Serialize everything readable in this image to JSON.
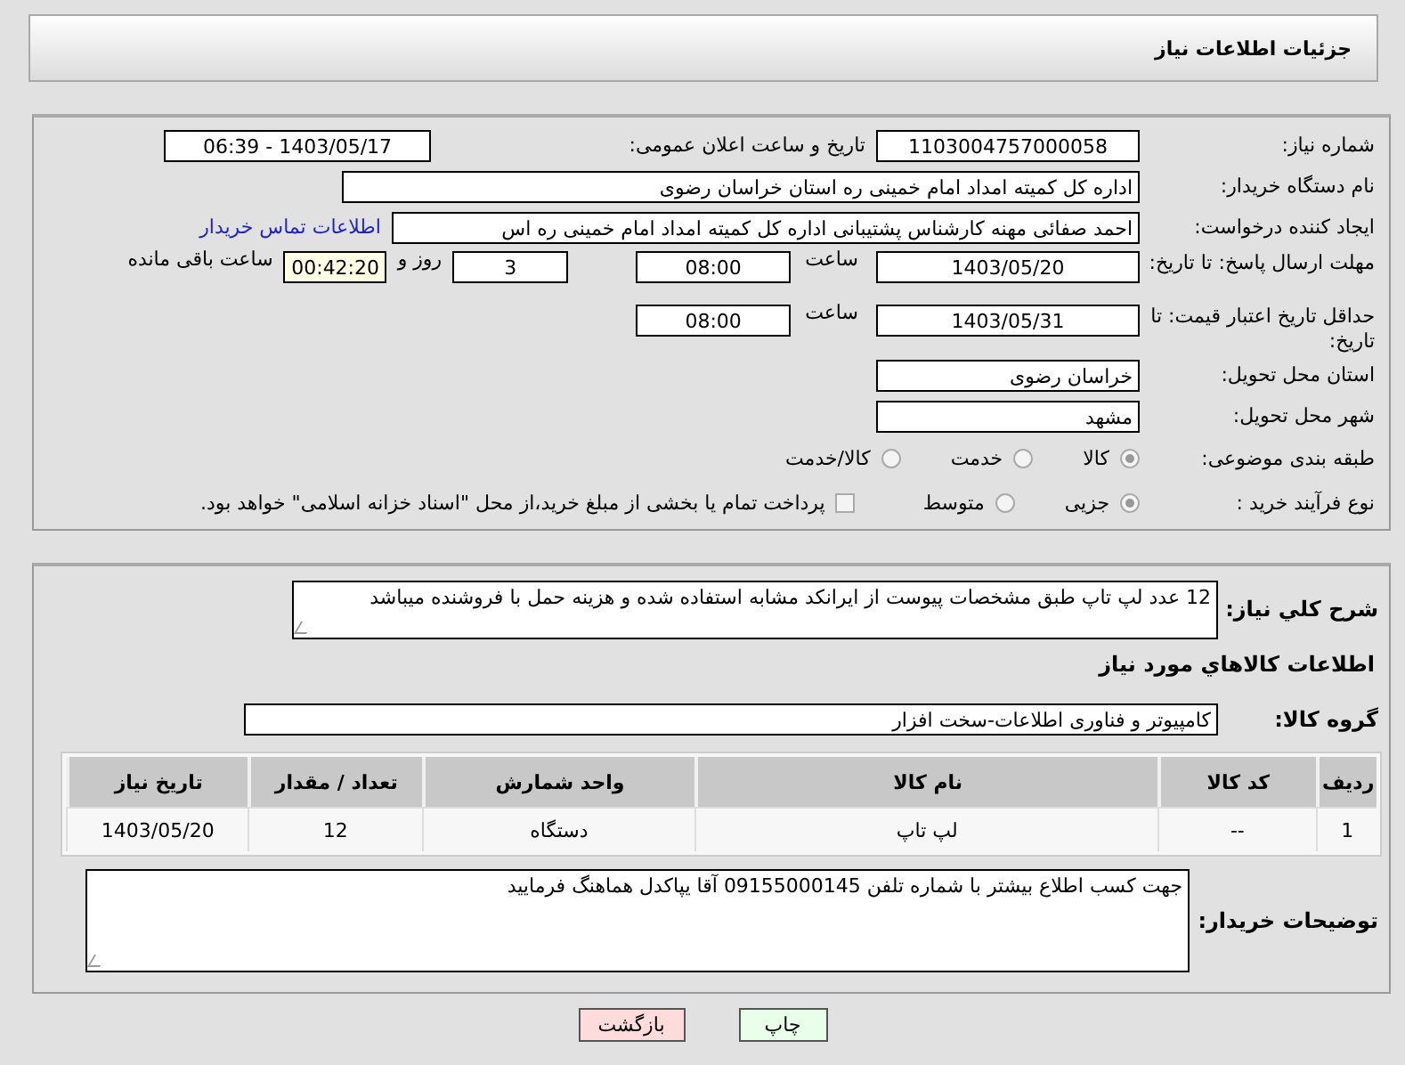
{
  "header": {
    "title": "جزئیات اطلاعات نیاز"
  },
  "details": {
    "need_number": {
      "label": "شماره نیاز:",
      "value": "1103004757000058"
    },
    "announce": {
      "label": "تاریخ و ساعت اعلان عمومی:",
      "value": "1403/05/17 - 06:39"
    },
    "buyer": {
      "label": "نام دستگاه خریدار:",
      "value": "اداره کل کمیته امداد امام خمینی  ره  استان خراسان رضوی"
    },
    "creator": {
      "label": "ایجاد کننده درخواست:",
      "value": "احمد صفائی مهنه کارشناس پشتیبانی اداره کل کمیته امداد امام خمینی  ره  اس",
      "link": "اطلاعات تماس خریدار"
    },
    "deadline": {
      "label": "مهلت ارسال پاسخ: تا تاریخ:",
      "date": "1403/05/20",
      "time_label": "ساعت",
      "time": "08:00",
      "days": "3",
      "days_label": "روز و",
      "remaining": "00:42:20",
      "remaining_label": "ساعت باقی مانده"
    },
    "validity": {
      "label": "حداقل تاریخ اعتبار قیمت: تا تاریخ:",
      "date": "1403/05/31",
      "time_label": "ساعت",
      "time": "08:00"
    },
    "province": {
      "label": "استان محل تحویل:",
      "value": "خراسان رضوی"
    },
    "city": {
      "label": "شهر محل تحویل:",
      "value": "مشهد"
    },
    "category": {
      "label": "طبقه بندی موضوعی:",
      "options": [
        {
          "label": "کالا",
          "selected": true
        },
        {
          "label": "خدمت",
          "selected": false
        },
        {
          "label": "کالا/خدمت",
          "selected": false
        }
      ]
    },
    "process": {
      "label": "نوع فرآیند خرید :",
      "options": [
        {
          "label": "جزیی",
          "selected": true
        },
        {
          "label": "متوسط",
          "selected": false
        }
      ],
      "payment": {
        "label": "پرداخت تمام یا بخشی از مبلغ خرید،از محل \"اسناد خزانه اسلامی\" خواهد بود.",
        "checked": false
      }
    }
  },
  "needs": {
    "description": {
      "label": "شرح کلي نياز:",
      "value": "12 عدد لپ تاپ طبق مشخصات پیوست از ایرانکد مشابه استفاده شده و هزینه حمل با فروشنده میباشد"
    },
    "goods_title": "اطلاعات كالاهاي مورد نياز",
    "group": {
      "label": "گروه کالا:",
      "value": "کامپیوتر و فناوری اطلاعات-سخت افزار"
    },
    "table": {
      "columns": [
        "ردیف",
        "کد کالا",
        "نام کالا",
        "واحد شمارش",
        "تعداد / مقدار",
        "تاریخ نیاز"
      ],
      "rows": [
        [
          "1",
          "--",
          "لپ تاپ",
          "دستگاه",
          "12",
          "1403/05/20"
        ]
      ]
    },
    "notes": {
      "label": "توضیحات خریدار:",
      "value": "جهت کسب اطلاع بیشتر با شماره تلفن 09155000145 آقا یپاکدل هماهنگ فرمایید"
    }
  },
  "buttons": [
    {
      "label": "چاپ",
      "kind": "print"
    },
    {
      "label": "بازگشت",
      "kind": "back"
    }
  ]
}
